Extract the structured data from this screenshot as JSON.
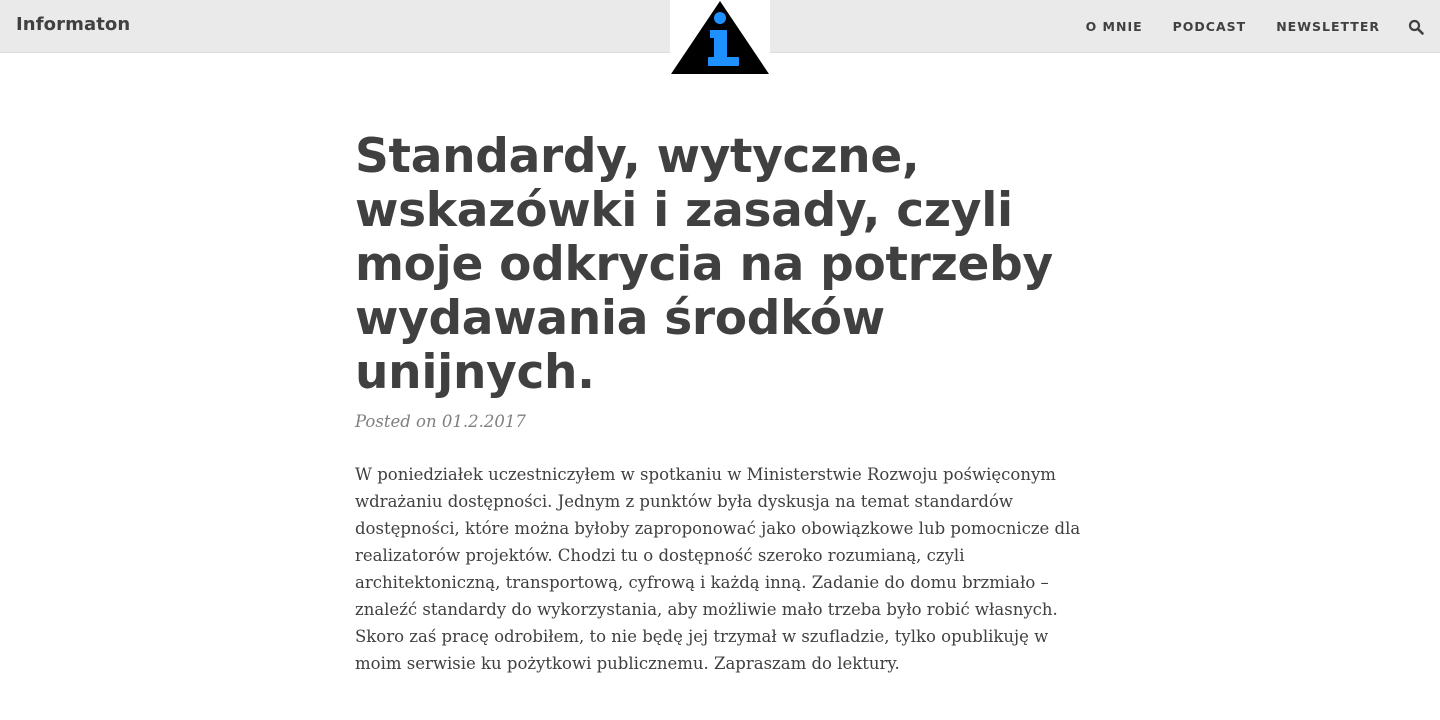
{
  "navbar": {
    "brand": "Informaton",
    "links": [
      "O MNIE",
      "PODCAST",
      "NEWSLETTER"
    ],
    "search_icon": "search-icon",
    "logo_icon": "info-triangle-logo",
    "colors": {
      "background": "#eaeaea",
      "logo_triangle": "#000000",
      "logo_glyph": "#1e90ff"
    }
  },
  "post": {
    "title": "Standardy, wytyczne, wskazówki i zasady, czyli moje odkrycia na potrzeby wydawania środków unijnych.",
    "meta": "Posted on 01.2.2017",
    "body": "W poniedziałek uczestniczyłem w spotkaniu w Ministerstwie Rozwoju poświęconym wdrażaniu dostępności. Jednym z punktów była dyskusja na temat standardów dostępności, które można byłoby zaproponować jako obowiązkowe lub pomocnicze dla realizatorów projektów. Chodzi tu o dostępność szeroko rozumianą, czyli architektoniczną, transportową, cyfrową i każdą inną. Zadanie do domu brzmiało – znaleźć standardy do wykorzystania, aby możliwie mało trzeba było robić własnych. Skoro zaś pracę odrobiłem, to nie będę jej trzymał w szufladzie, tylko opublikuję w moim serwisie ku pożytkowi publicznemu. Zapraszam do lektury."
  }
}
